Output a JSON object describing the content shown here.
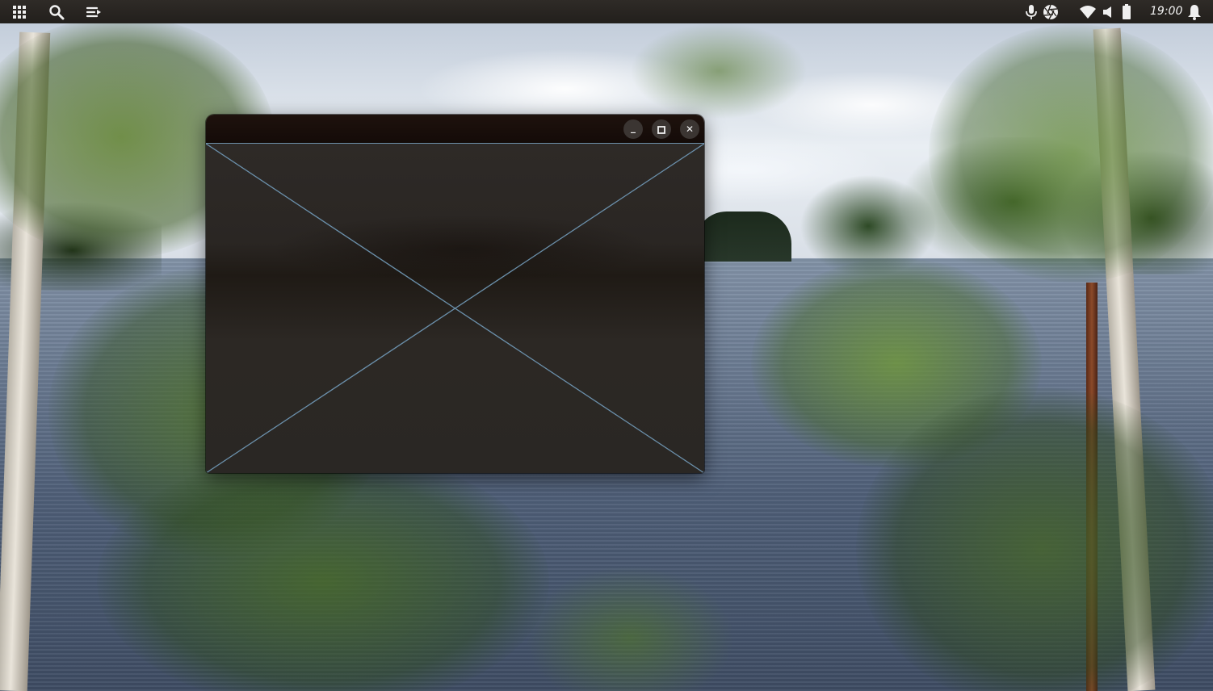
{
  "topbar": {
    "left_icons": [
      "apps-grid-icon",
      "search-icon",
      "menu-list-icon"
    ],
    "right_icons": [
      "microphone-icon",
      "camera-shutter-icon",
      "wifi-icon",
      "volume-icon",
      "battery-icon",
      "bell-icon"
    ],
    "clock": "19:00"
  },
  "window": {
    "title": "",
    "controls": {
      "minimize_label": "_",
      "maximize_icon": "maximize-icon",
      "close_label": "✕"
    },
    "content": "image-placeholder"
  },
  "colors": {
    "topbar_bg": "#2a2622",
    "titlebar_bg": "#1a0f0b",
    "window_body": "#2c2824",
    "placeholder_lines": "#6b90ab"
  }
}
